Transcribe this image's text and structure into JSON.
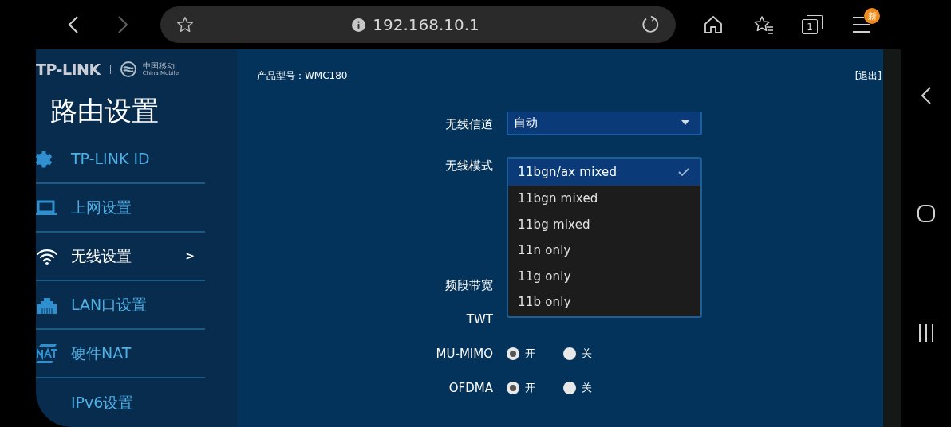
{
  "browser": {
    "url": "192.168.10.1",
    "forward_disabled": true,
    "tab_count": "1",
    "menu_badge": "新"
  },
  "logo": {
    "brand": "TP-LINK",
    "partner_cn": "中国移动",
    "partner_en": "China Mobile"
  },
  "header": {
    "model": "产品型号：WMC180",
    "logout": "[退出]"
  },
  "sidebar": {
    "title": "路由设置",
    "items": [
      {
        "label": "TP-LINK ID",
        "kind": "gear",
        "selected": false
      },
      {
        "label": "上网设置",
        "kind": "laptop",
        "selected": false
      },
      {
        "label": "无线设置",
        "kind": "wifi",
        "selected": true,
        "arrow": ">"
      },
      {
        "label": "LAN口设置",
        "kind": "lan",
        "selected": false
      },
      {
        "label": "硬件NAT",
        "kind": "nat",
        "selected": false
      },
      {
        "label": "IPv6设置",
        "selected": false
      }
    ]
  },
  "form": {
    "rows": [
      {
        "label": "无线信道",
        "kind": "select",
        "value": "自动"
      },
      {
        "label": "无线模式",
        "kind": "dropdown",
        "options": [
          {
            "label": "11bgn/ax mixed",
            "selected": true
          },
          {
            "label": "11bgn mixed",
            "selected": false
          },
          {
            "label": "11bg mixed",
            "selected": false
          },
          {
            "label": "11n only",
            "selected": false
          },
          {
            "label": "11g only",
            "selected": false
          },
          {
            "label": "11b only",
            "selected": false
          }
        ]
      },
      {
        "label": "频段带宽",
        "kind": "label"
      },
      {
        "label": "TWT",
        "kind": "label"
      },
      {
        "label": "MU-MIMO",
        "kind": "radio",
        "options": [
          {
            "label": "开",
            "selected": true
          },
          {
            "label": "关",
            "selected": false
          }
        ]
      },
      {
        "label": "OFDMA",
        "kind": "radio",
        "options": [
          {
            "label": "开",
            "selected": true
          },
          {
            "label": "关",
            "selected": false
          }
        ]
      }
    ]
  }
}
